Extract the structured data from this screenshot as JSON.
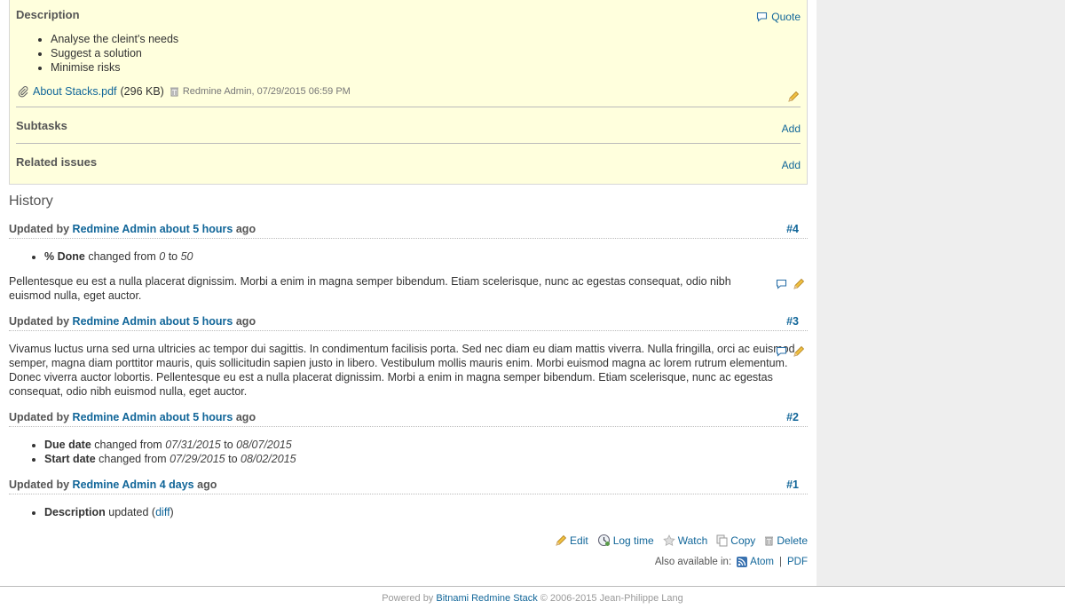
{
  "description": {
    "title": "Description",
    "quote_label": "Quote",
    "items": [
      "Analyse the cleint's needs",
      "Suggest a solution",
      "Minimise risks"
    ]
  },
  "attachment": {
    "filename": "About Stacks.pdf",
    "size": "(296 KB)",
    "author_date": "Redmine Admin, 07/29/2015 06:59 PM"
  },
  "subtasks": {
    "title": "Subtasks",
    "add_label": "Add"
  },
  "related": {
    "title": "Related issues",
    "add_label": "Add"
  },
  "history": {
    "title": "History",
    "journals": [
      {
        "prefix": "Updated by",
        "author": "Redmine Admin",
        "time": "about 5 hours",
        "suffix": "ago",
        "number": "#4",
        "details": [
          {
            "field": "% Done",
            "verb": "changed from",
            "from": "0",
            "to_word": "to",
            "to": "50"
          }
        ],
        "note": "Pellentesque eu est a nulla placerat dignissim. Morbi a enim in magna semper bibendum. Etiam scelerisque, nunc ac egestas consequat, odio nibh euismod nulla, eget auctor."
      },
      {
        "prefix": "Updated by",
        "author": "Redmine Admin",
        "time": "about 5 hours",
        "suffix": "ago",
        "number": "#3",
        "note": "Vivamus luctus urna sed urna ultricies ac tempor dui sagittis. In condimentum facilisis porta. Sed nec diam eu diam mattis viverra. Nulla fringilla, orci ac euismod semper, magna diam porttitor mauris, quis sollicitudin sapien justo in libero. Vestibulum mollis mauris enim. Morbi euismod magna ac lorem rutrum elementum. Donec viverra auctor lobortis. Pellentesque eu est a nulla placerat dignissim. Morbi a enim in magna semper bibendum. Etiam scelerisque, nunc ac egestas consequat, odio nibh euismod nulla, eget auctor."
      },
      {
        "prefix": "Updated by",
        "author": "Redmine Admin",
        "time": "about 5 hours",
        "suffix": "ago",
        "number": "#2",
        "details": [
          {
            "field": "Due date",
            "verb": "changed from",
            "from": "07/31/2015",
            "to_word": "to",
            "to": "08/07/2015"
          },
          {
            "field": "Start date",
            "verb": "changed from",
            "from": "07/29/2015",
            "to_word": "to",
            "to": "08/02/2015"
          }
        ]
      },
      {
        "prefix": "Updated by",
        "author": "Redmine Admin",
        "time": "4 days",
        "suffix": "ago",
        "number": "#1",
        "details": [
          {
            "field": "Description",
            "verb": "updated",
            "link": "diff"
          }
        ]
      }
    ]
  },
  "actions": {
    "edit": "Edit",
    "log_time": "Log time",
    "watch": "Watch",
    "copy": "Copy",
    "delete": "Delete"
  },
  "other_formats": {
    "label": "Also available in:",
    "atom": "Atom",
    "sep": "|",
    "pdf": "PDF"
  },
  "footer": {
    "powered_by": "Powered by",
    "link": "Bitnami Redmine Stack",
    "copyright": "© 2006-2015 Jean-Philippe Lang"
  },
  "colors": {
    "link": "#116699",
    "issue_bg": "#ffffdd",
    "sidebar_bg": "#eeeeee"
  }
}
